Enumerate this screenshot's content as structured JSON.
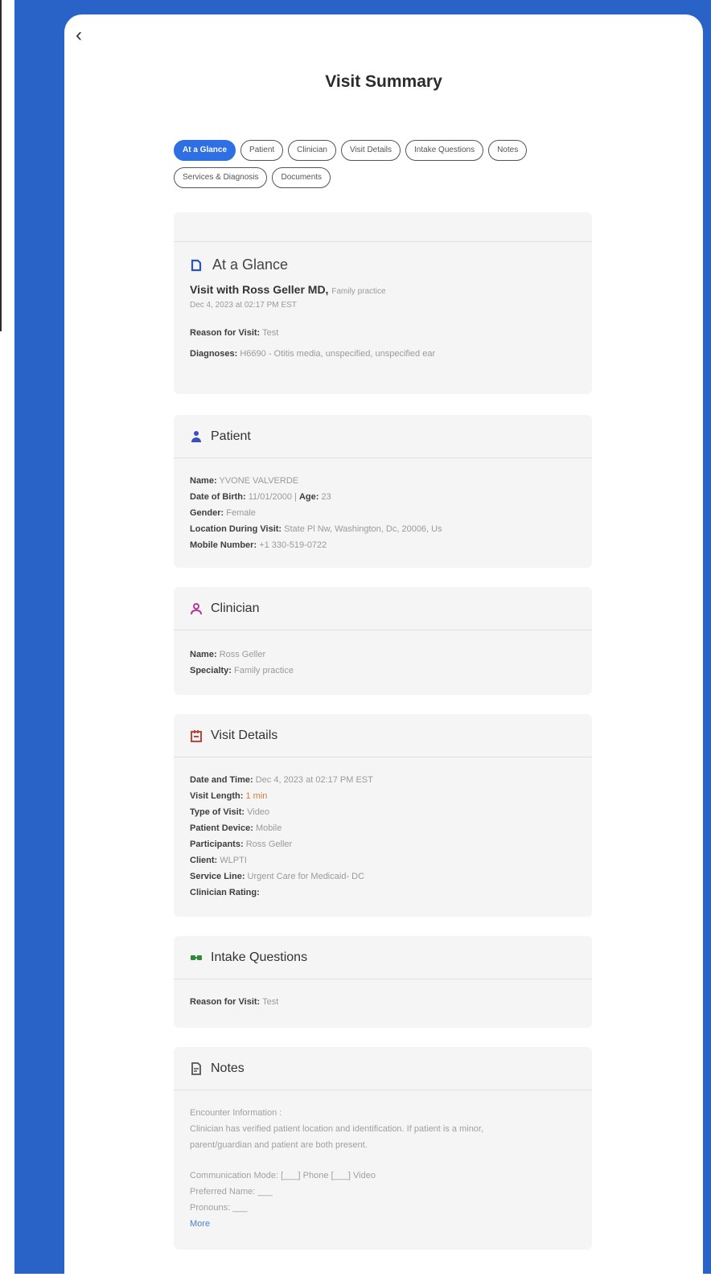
{
  "header": {
    "title": "Visit Summary",
    "back_icon": "chevron-left-icon"
  },
  "tabs": [
    {
      "label": "At a Glance",
      "active": true
    },
    {
      "label": "Patient"
    },
    {
      "label": "Clinician"
    },
    {
      "label": "Visit Details"
    },
    {
      "label": "Intake Questions"
    },
    {
      "label": "Notes"
    },
    {
      "label": "Services & Diagnosis"
    },
    {
      "label": "Documents"
    }
  ],
  "glance": {
    "title": "At a Glance",
    "visit_with": "Visit with Ross Geller MD,",
    "specialty": "Family practice",
    "datetime": "Dec 4, 2023 at 02:17 PM EST",
    "reason_label": "Reason for Visit:",
    "reason_value": "Test",
    "diagnoses_label": "Diagnoses:",
    "diagnoses_value": "H6690 - Otitis media, unspecified, unspecified ear"
  },
  "patient": {
    "title": "Patient",
    "name_label": "Name:",
    "name_value": "YVONE VALVERDE",
    "dob_label": "Date of Birth:",
    "dob_value": "11/01/2000",
    "separator": "|",
    "age_label": "Age:",
    "age_value": "23",
    "gender_label": "Gender:",
    "gender_value": "Female",
    "location_label": "Location During Visit:",
    "location_value": "State Pl Nw, Washington, Dc, 20006, Us",
    "mobile_label": "Mobile Number:",
    "mobile_value": "+1 330-519-0722"
  },
  "clinician": {
    "title": "Clinician",
    "name_label": "Name:",
    "name_value": "Ross Geller",
    "specialty_label": "Specialty:",
    "specialty_value": "Family practice"
  },
  "visit_details": {
    "title": "Visit Details",
    "datetime_label": "Date and Time:",
    "datetime_value": "Dec 4, 2023 at 02:17 PM EST",
    "length_label": "Visit Length:",
    "length_value": "1 min",
    "type_label": "Type of Visit:",
    "type_value": "Video",
    "device_label": "Patient Device:",
    "device_value": "Mobile",
    "participants_label": "Participants:",
    "participants_value": "Ross Geller",
    "client_label": "Client:",
    "client_value": "WLPTI",
    "service_label": "Service Line:",
    "service_value": "Urgent Care for Medicaid- DC",
    "rating_label": "Clinician Rating:"
  },
  "intake": {
    "title": "Intake Questions",
    "reason_label": "Reason for Visit:",
    "reason_value": "Test"
  },
  "notes": {
    "title": "Notes",
    "line1": "Encounter Information :",
    "line2": "Clinician has verified patient location and identification. If patient is a minor,",
    "line3": "parent/guardian and patient are both present.",
    "line4": "Communication Mode: [___] Phone [___] Video",
    "line5": "Preferred Name: ___",
    "line6": "Pronouns: ___",
    "more": "More"
  },
  "colors": {
    "brand_blue": "#2a63c7",
    "tab_active": "#2f6fe4",
    "card_bg": "#f5f5f6"
  }
}
